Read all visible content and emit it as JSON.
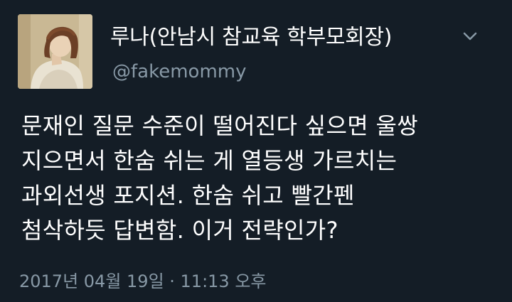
{
  "author": {
    "display_name": "루나(안남시 참교육 학부모회장)",
    "handle": "@fakemommy",
    "avatar_icon": "portrait-painting-avatar"
  },
  "menu": {
    "icon": "chevron-down-icon"
  },
  "tweet": {
    "lines": [
      "문재인 질문 수준이 떨어진다 싶으면 울쌍",
      "지으면서 한숨 쉬는 게 열등생 가르치는",
      "과외선생 포지션. 한숨 쉬고 빨간펜",
      "첨삭하듯 답변함. 이거 전략인가?"
    ],
    "timestamp": "2017년 04월 19일 · 11:13 오후"
  },
  "colors": {
    "background": "#141d26",
    "primary_text": "#ffffff",
    "secondary_text": "#8899a6"
  }
}
